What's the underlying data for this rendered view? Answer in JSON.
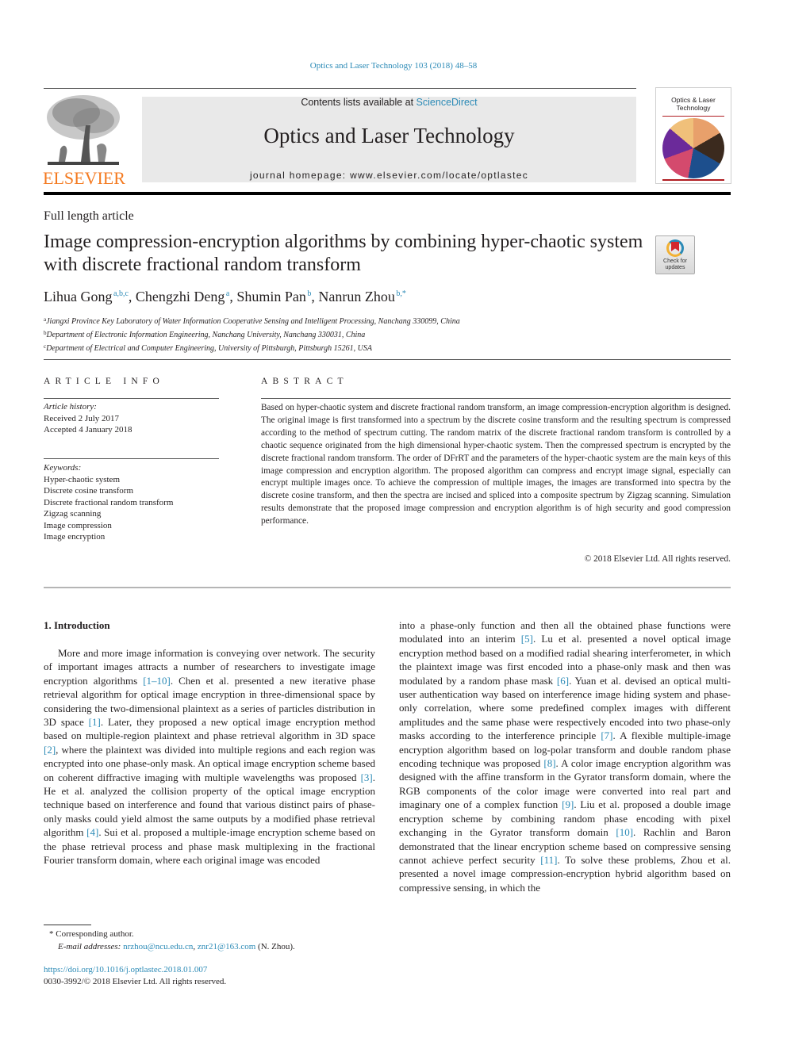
{
  "journal_ref": "Optics and Laser Technology 103 (2018) 48–58",
  "masthead": {
    "contents_prefix": "Contents lists available at ",
    "contents_link": "ScienceDirect",
    "journal_title": "Optics and Laser Technology",
    "homepage_prefix": "journal homepage: ",
    "homepage_url": "www.elsevier.com/locate/optlastec"
  },
  "publisher_logo": {
    "word": "ELSEVIER",
    "icon": "tree-icon",
    "color": "#f47a20"
  },
  "cover": {
    "title_line1": "Optics & Laser",
    "title_line2": "Technology"
  },
  "check_updates": {
    "line1": "Check for",
    "line2": "updates"
  },
  "article": {
    "type": "Full length article",
    "title": "Image compression-encryption algorithms by combining hyper-chaotic system with discrete fractional random transform",
    "authors": [
      {
        "name": "Lihua Gong",
        "sup": "a,b,c"
      },
      {
        "name": "Chengzhi Deng",
        "sup": "a"
      },
      {
        "name": "Shumin Pan",
        "sup": "b"
      },
      {
        "name": "Nanrun Zhou",
        "sup": "b,*"
      }
    ],
    "affiliations": [
      {
        "mark": "a",
        "text": "Jiangxi Province Key Laboratory of Water Information Cooperative Sensing and Intelligent Processing, Nanchang 330099, China"
      },
      {
        "mark": "b",
        "text": "Department of Electronic Information Engineering, Nanchang University, Nanchang 330031, China"
      },
      {
        "mark": "c",
        "text": "Department of Electrical and Computer Engineering, University of Pittsburgh, Pittsburgh 15261, USA"
      }
    ]
  },
  "article_info": {
    "heading": "ARTICLE INFO",
    "history_label": "Article history:",
    "received": "Received 2 July 2017",
    "accepted": "Accepted 4 January 2018",
    "keywords_label": "Keywords:",
    "keywords": [
      "Hyper-chaotic system",
      "Discrete cosine transform",
      "Discrete fractional random transform",
      "Zigzag scanning",
      "Image compression",
      "Image encryption"
    ]
  },
  "abstract": {
    "heading": "ABSTRACT",
    "text": "Based on hyper-chaotic system and discrete fractional random transform, an image compression-encryption algorithm is designed. The original image is first transformed into a spectrum by the discrete cosine transform and the resulting spectrum is compressed according to the method of spectrum cutting. The random matrix of the discrete fractional random transform is controlled by a chaotic sequence originated from the high dimensional hyper-chaotic system. Then the compressed spectrum is encrypted by the discrete fractional random transform. The order of DFrRT and the parameters of the hyper-chaotic system are the main keys of this image compression and encryption algorithm. The proposed algorithm can compress and encrypt image signal, especially can encrypt multiple images once. To achieve the compression of multiple images, the images are transformed into spectra by the discrete cosine transform, and then the spectra are incised and spliced into a composite spectrum by Zigzag scanning. Simulation results demonstrate that the proposed image compression and encryption algorithm is of high security and good compression performance.",
    "copyright": "© 2018 Elsevier Ltd. All rights reserved."
  },
  "introduction": {
    "heading": "1. Introduction",
    "left": [
      {
        "t": "More and more image information is conveying over network. The security of important images attracts a number of researchers to investigate image encryption algorithms "
      },
      {
        "ref": "[1–10]"
      },
      {
        "t": ". Chen et al. presented a new iterative phase retrieval algorithm for optical image encryption in three-dimensional space by considering the two-dimensional plaintext as a series of particles distribution in 3D space "
      },
      {
        "ref": "[1]"
      },
      {
        "t": ". Later, they proposed a new optical image encryption method based on multiple-region plaintext and phase retrieval algorithm in 3D space "
      },
      {
        "ref": "[2]"
      },
      {
        "t": ", where the plaintext was divided into multiple regions and each region was encrypted into one phase-only mask. An optical image encryption scheme based on coherent diffractive imaging with multiple wavelengths was proposed "
      },
      {
        "ref": "[3]"
      },
      {
        "t": ". He et al. analyzed the collision property of the optical image encryption technique based on interference and found that various distinct pairs of phase-only masks could yield almost the same outputs by a modified phase retrieval algorithm "
      },
      {
        "ref": "[4]"
      },
      {
        "t": ". Sui et al. proposed a multiple-image encryption scheme based on the phase retrieval process and phase mask multiplexing in the fractional Fourier transform domain, where each original image was encoded"
      }
    ],
    "right": [
      {
        "t": "into a phase-only function and then all the obtained phase functions were modulated into an interim "
      },
      {
        "ref": "[5]"
      },
      {
        "t": ". Lu et al. presented a novel optical image encryption method based on a modified radial shearing interferometer, in which the plaintext image was first encoded into a phase-only mask and then was modulated by a random phase mask "
      },
      {
        "ref": "[6]"
      },
      {
        "t": ". Yuan et al. devised an optical multi-user authentication way based on interference image hiding system and phase-only correlation, where some predefined complex images with different amplitudes and the same phase were respectively encoded into two phase-only masks according to the interference principle "
      },
      {
        "ref": "[7]"
      },
      {
        "t": ". A flexible multiple-image encryption algorithm based on log-polar transform and double random phase encoding technique was proposed "
      },
      {
        "ref": "[8]"
      },
      {
        "t": ". A color image encryption algorithm was designed with the affine transform in the Gyrator transform domain, where the RGB components of the color image were converted into real part and imaginary one of a complex function "
      },
      {
        "ref": "[9]"
      },
      {
        "t": ". Liu et al. proposed a double image encryption scheme by combining random phase encoding with pixel exchanging in the Gyrator transform domain "
      },
      {
        "ref": "[10]"
      },
      {
        "t": ". Rachlin and Baron demonstrated that the linear encryption scheme based on compressive sensing cannot achieve perfect security "
      },
      {
        "ref": "[11]"
      },
      {
        "t": ". To solve these problems, Zhou et al. presented a novel image compression-encryption hybrid algorithm based on compressive sensing, in which the"
      }
    ]
  },
  "footnotes": {
    "corresponding": "Corresponding author.",
    "corresponding_mark": "*",
    "email_label": "E-mail addresses:",
    "email1": "nrzhou@ncu.edu.cn",
    "email2": "znr21@163.com",
    "email_suffix": "(N. Zhou).",
    "doi": "https://doi.org/10.1016/j.optlastec.2018.01.007",
    "issn": "0030-3992/© 2018 Elsevier Ltd. All rights reserved."
  }
}
